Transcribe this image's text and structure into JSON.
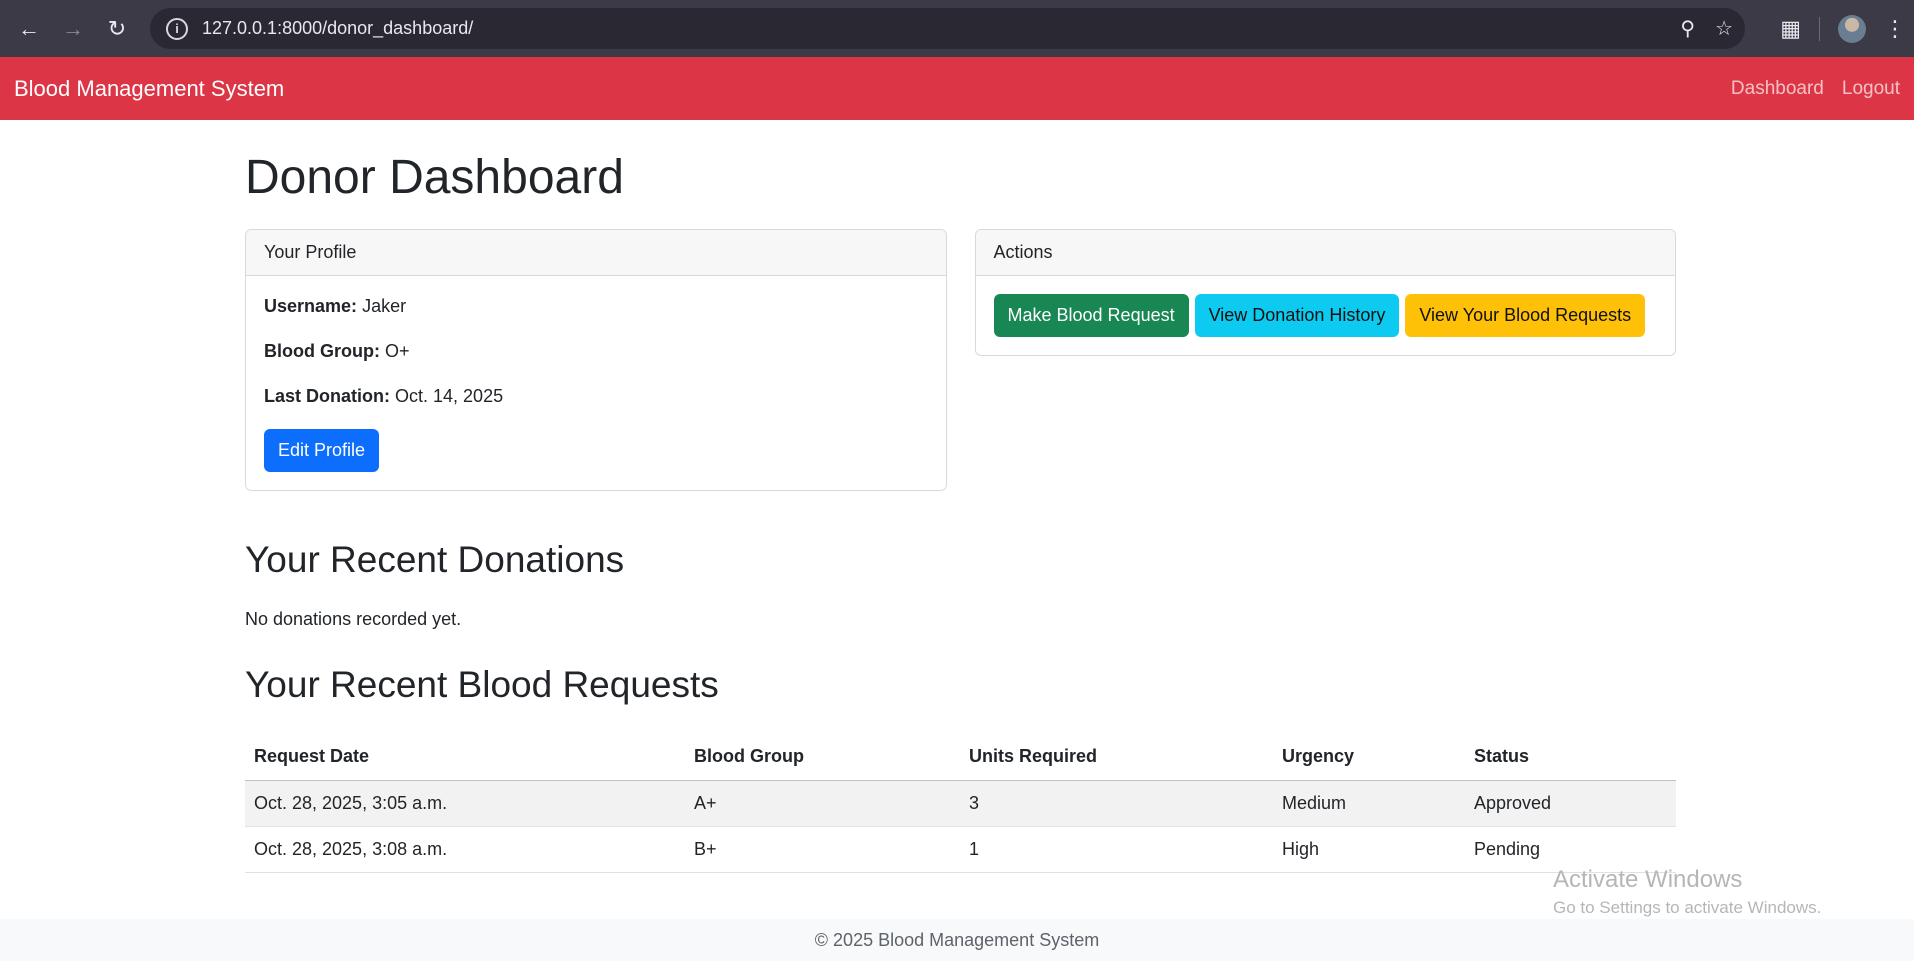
{
  "browser": {
    "url": "127.0.0.1:8000/donor_dashboard/"
  },
  "navbar": {
    "brand": "Blood Management System",
    "links": [
      "Dashboard",
      "Logout"
    ]
  },
  "page": {
    "title": "Donor Dashboard"
  },
  "profile": {
    "header": "Your Profile",
    "username_label": "Username:",
    "username": "Jaker",
    "blood_group_label": "Blood Group:",
    "blood_group": "O+",
    "last_donation_label": "Last Donation:",
    "last_donation": "Oct. 14, 2025",
    "edit_button": "Edit Profile"
  },
  "actions": {
    "header": "Actions",
    "buttons": [
      "Make Blood Request",
      "View Donation History",
      "View Your Blood Requests"
    ]
  },
  "donations": {
    "title": "Your Recent Donations",
    "empty_text": "No donations recorded yet."
  },
  "requests": {
    "title": "Your Recent Blood Requests",
    "columns": [
      "Request Date",
      "Blood Group",
      "Units Required",
      "Urgency",
      "Status"
    ],
    "rows": [
      [
        "Oct. 28, 2025, 3:05 a.m.",
        "A+",
        "3",
        "Medium",
        "Approved"
      ],
      [
        "Oct. 28, 2025, 3:08 a.m.",
        "B+",
        "1",
        "High",
        "Pending"
      ]
    ]
  },
  "watermark": {
    "title": "Activate Windows",
    "subtitle": "Go to Settings to activate Windows."
  },
  "footer": {
    "text": "© 2025 Blood Management System"
  },
  "colors": {
    "navbar": "#dc3545",
    "primary": "#0d6efd",
    "success": "#198754",
    "info": "#0dcaf0",
    "warning": "#ffc107"
  },
  "icons": [
    "back-arrow-icon",
    "forward-arrow-icon",
    "reload-icon",
    "site-info-icon",
    "zoom-icon",
    "bookmark-star-icon",
    "extensions-icon",
    "profile-avatar",
    "menu-dots-icon"
  ]
}
